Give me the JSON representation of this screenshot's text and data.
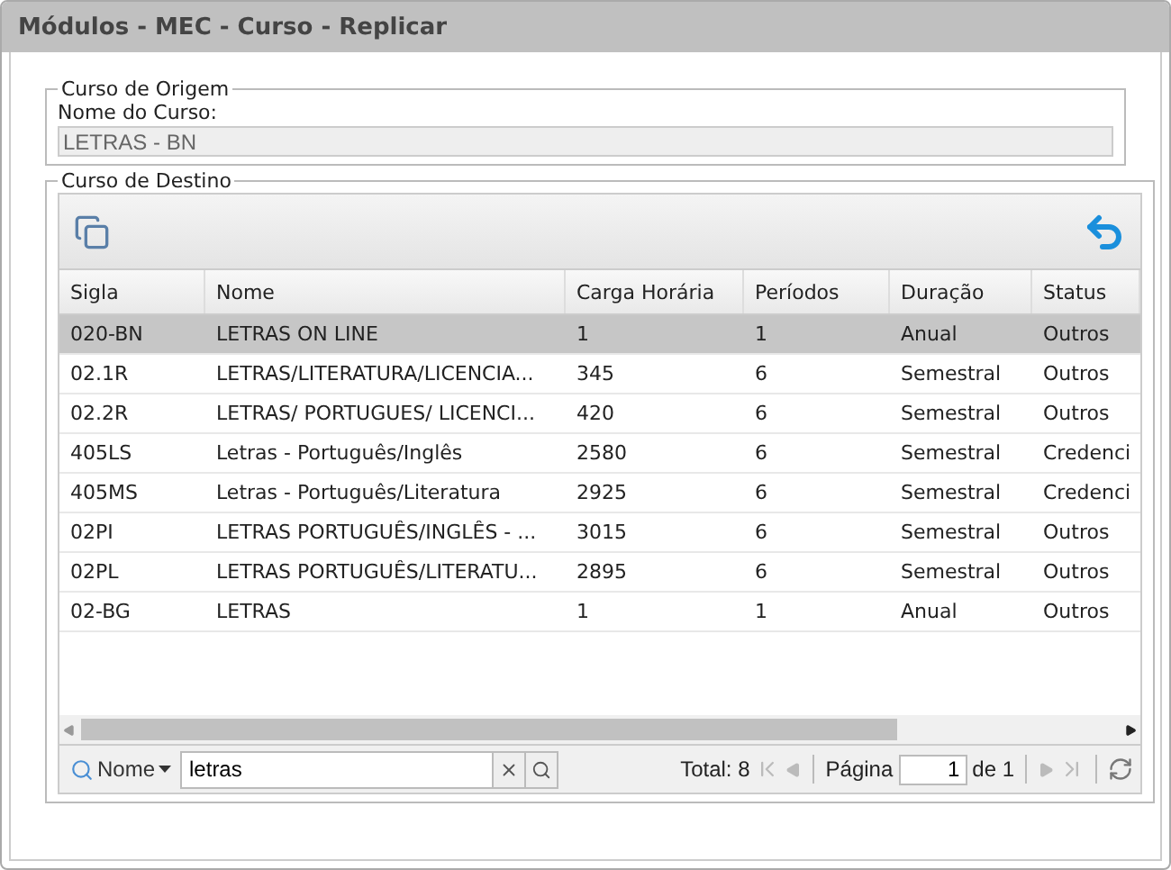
{
  "window": {
    "title": "Módulos - MEC - Curso - Replicar"
  },
  "origin": {
    "legend": "Curso de Origem",
    "label": "Nome do Curso:",
    "value": "LETRAS - BN"
  },
  "destination": {
    "legend": "Curso de Destino",
    "columns": [
      "Sigla",
      "Nome",
      "Carga Horária",
      "Períodos",
      "Duração",
      "Status"
    ],
    "rows": [
      {
        "cells": [
          "020-BN",
          "LETRAS ON LINE",
          "1",
          "1",
          "Anual",
          "Outros"
        ],
        "selected": true
      },
      {
        "cells": [
          "02.1R",
          "LETRAS/LITERATURA/LICENCIA...",
          "345",
          "6",
          "Semestral",
          "Outros"
        ],
        "selected": false
      },
      {
        "cells": [
          "02.2R",
          "LETRAS/ PORTUGUES/ LICENCI...",
          "420",
          "6",
          "Semestral",
          "Outros"
        ],
        "selected": false
      },
      {
        "cells": [
          "405LS",
          "Letras - Português/Inglês",
          "2580",
          "6",
          "Semestral",
          "Credenci"
        ],
        "selected": false
      },
      {
        "cells": [
          "405MS",
          "Letras - Português/Literatura",
          "2925",
          "6",
          "Semestral",
          "Credenci"
        ],
        "selected": false
      },
      {
        "cells": [
          "02PI",
          "LETRAS PORTUGUÊS/INGLÊS - ...",
          "3015",
          "6",
          "Semestral",
          "Outros"
        ],
        "selected": false
      },
      {
        "cells": [
          "02PL",
          "LETRAS PORTUGUÊS/LITERATU...",
          "2895",
          "6",
          "Semestral",
          "Outros"
        ],
        "selected": false
      },
      {
        "cells": [
          "02-BG",
          "LETRAS",
          "1",
          "1",
          "Anual",
          "Outros"
        ],
        "selected": false
      }
    ],
    "pager": {
      "filter_label": "Nome",
      "search": "letras",
      "total": "Total: 8",
      "page_label": "Página",
      "page": "1",
      "page_count": "de 1"
    }
  }
}
